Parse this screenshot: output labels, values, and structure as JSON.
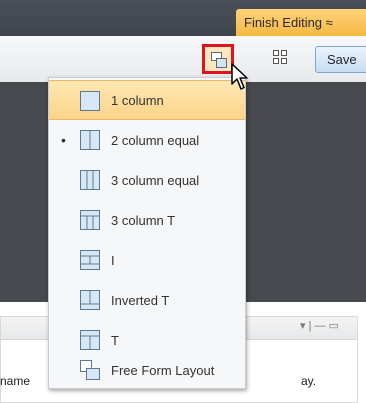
{
  "header": {
    "finish_editing_label": "Finish Editing ≈"
  },
  "toolbar": {
    "layout_icon": "layout-icon",
    "grid_icon": "grid-icon",
    "save_label": "Save"
  },
  "layout_menu": {
    "items": [
      {
        "label": "1 column",
        "icon": "layout-1-column-icon",
        "selected": true,
        "current": false
      },
      {
        "label": "2 column equal",
        "icon": "layout-2-column-equal-icon",
        "selected": false,
        "current": true
      },
      {
        "label": "3 column equal",
        "icon": "layout-3-column-equal-icon",
        "selected": false,
        "current": false
      },
      {
        "label": "3 column T",
        "icon": "layout-3-column-t-icon",
        "selected": false,
        "current": false
      },
      {
        "label": "I",
        "icon": "layout-i-icon",
        "selected": false,
        "current": false
      },
      {
        "label": "Inverted T",
        "icon": "layout-inverted-t-icon",
        "selected": false,
        "current": false
      },
      {
        "label": "T",
        "icon": "layout-t-icon",
        "selected": false,
        "current": false
      },
      {
        "label": "Free Form Layout",
        "icon": "layout-free-form-icon",
        "selected": false,
        "current": false
      }
    ],
    "bullet": "•"
  },
  "panel": {
    "left_text": "name",
    "right_text": "ay.",
    "tools": "▾ | — ▭"
  },
  "colors": {
    "highlight_border": "#e0151b",
    "finish_button": "#f5b843",
    "selection": "#fbd488"
  }
}
